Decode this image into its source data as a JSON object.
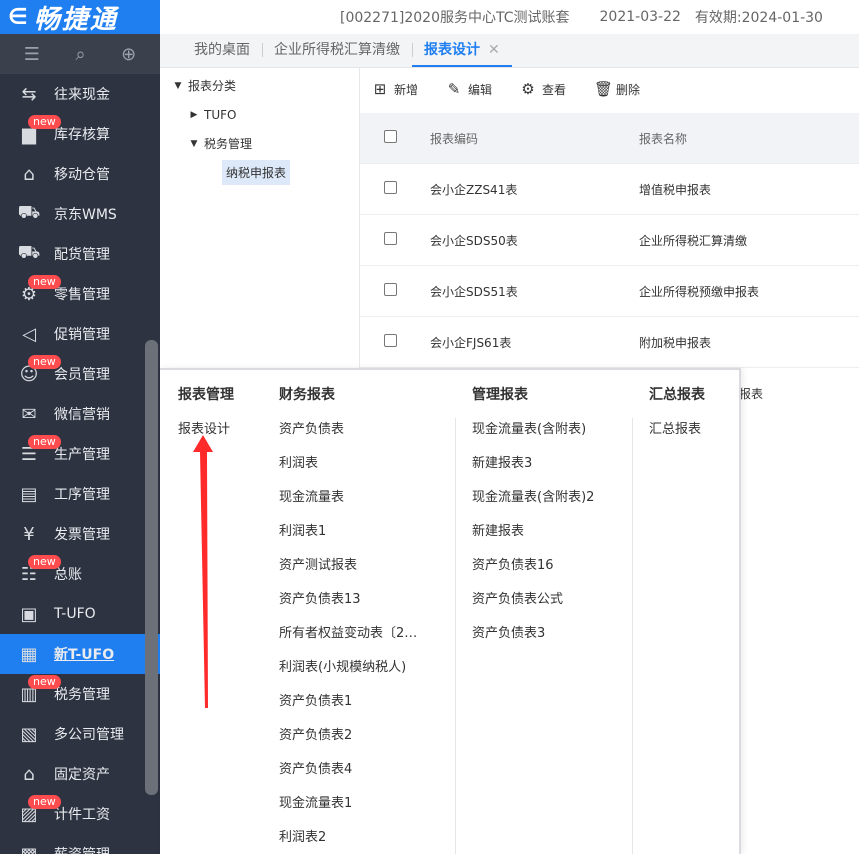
{
  "app": {
    "logo_text": "畅捷通",
    "logo_mark": "∈"
  },
  "header": {
    "account": "[002271]2020服务中心TC测试账套",
    "date": "2021-03-22",
    "valid": "有效期:2024-01-30"
  },
  "tabs": [
    {
      "label": "我的桌面"
    },
    {
      "label": "企业所得税汇算清缴"
    },
    {
      "label": "报表设计",
      "close": "✕"
    }
  ],
  "sidebar": {
    "items": [
      {
        "label": "往来现金",
        "icon": "⇆",
        "new": ""
      },
      {
        "label": "库存核算",
        "icon": "▆",
        "new": "new"
      },
      {
        "label": "移动仓管",
        "icon": "⌂",
        "new": ""
      },
      {
        "label": "京东WMS",
        "icon": "⛟",
        "new": ""
      },
      {
        "label": "配货管理",
        "icon": "⛟",
        "new": ""
      },
      {
        "label": "零售管理",
        "icon": "⚙",
        "new": "new"
      },
      {
        "label": "促销管理",
        "icon": "◁",
        "new": ""
      },
      {
        "label": "会员管理",
        "icon": "☺",
        "new": "new"
      },
      {
        "label": "微信营销",
        "icon": "✉",
        "new": ""
      },
      {
        "label": "生产管理",
        "icon": "☰",
        "new": "new"
      },
      {
        "label": "工序管理",
        "icon": "▤",
        "new": ""
      },
      {
        "label": "发票管理",
        "icon": "¥",
        "new": ""
      },
      {
        "label": "总账",
        "icon": "☷",
        "new": "new"
      },
      {
        "label": "T-UFO",
        "icon": "▣",
        "new": ""
      },
      {
        "label": "新T-UFO",
        "icon": "▦",
        "new": ""
      },
      {
        "label": "税务管理",
        "icon": "▥",
        "new": "new"
      },
      {
        "label": "多公司管理",
        "icon": "▧",
        "new": ""
      },
      {
        "label": "固定资产",
        "icon": "⌂",
        "new": ""
      },
      {
        "label": "计件工资",
        "icon": "▨",
        "new": "new"
      },
      {
        "label": "薪资管理",
        "icon": "▩",
        "new": ""
      }
    ]
  },
  "tree": {
    "root": "报表分类",
    "children": [
      "TUFO",
      "税务管理"
    ],
    "leaf": "纳税申报表"
  },
  "toolbar": {
    "add": "新增",
    "edit": "编辑",
    "view": "查看",
    "delete": "删除"
  },
  "table": {
    "headers": {
      "code": "报表编码",
      "name": "报表名称"
    },
    "rows": [
      {
        "code": "会小企ZZS41表",
        "name": "增值税申报表"
      },
      {
        "code": "会小企SDS50表",
        "name": "企业所得税汇算清缴"
      },
      {
        "code": "会小企SDS51表",
        "name": "企业所得税预缴申报表"
      },
      {
        "code": "会小企FJS61表",
        "name": "附加税申报表"
      }
    ],
    "partial_name": "报表"
  },
  "menu": {
    "col1": {
      "title": "报表管理",
      "items": [
        "报表设计"
      ]
    },
    "col2": {
      "title": "财务报表",
      "items": [
        "资产负债表",
        "利润表",
        "现金流量表",
        "利润表1",
        "资产测试报表",
        "资产负债表13",
        "所有者权益变动表〔2…",
        "利润表(小规模纳税人)",
        "资产负债表1",
        "资产负债表2",
        "资产负债表4",
        "现金流量表1",
        "利润表2"
      ]
    },
    "col3": {
      "title": "管理报表",
      "items": [
        "现金流量表(含附表)",
        "新建报表3",
        "现金流量表(含附表)2",
        "新建报表",
        "资产负债表16",
        "资产负债表公式",
        "资产负债表3"
      ]
    },
    "col4": {
      "title": "汇总报表",
      "items": [
        "汇总报表"
      ]
    }
  },
  "colors": {
    "brand": "#1f7ff0",
    "sidebar": "#2d3340",
    "new_badge": "#ff4d4f",
    "arrow": "#ff2a2a"
  }
}
